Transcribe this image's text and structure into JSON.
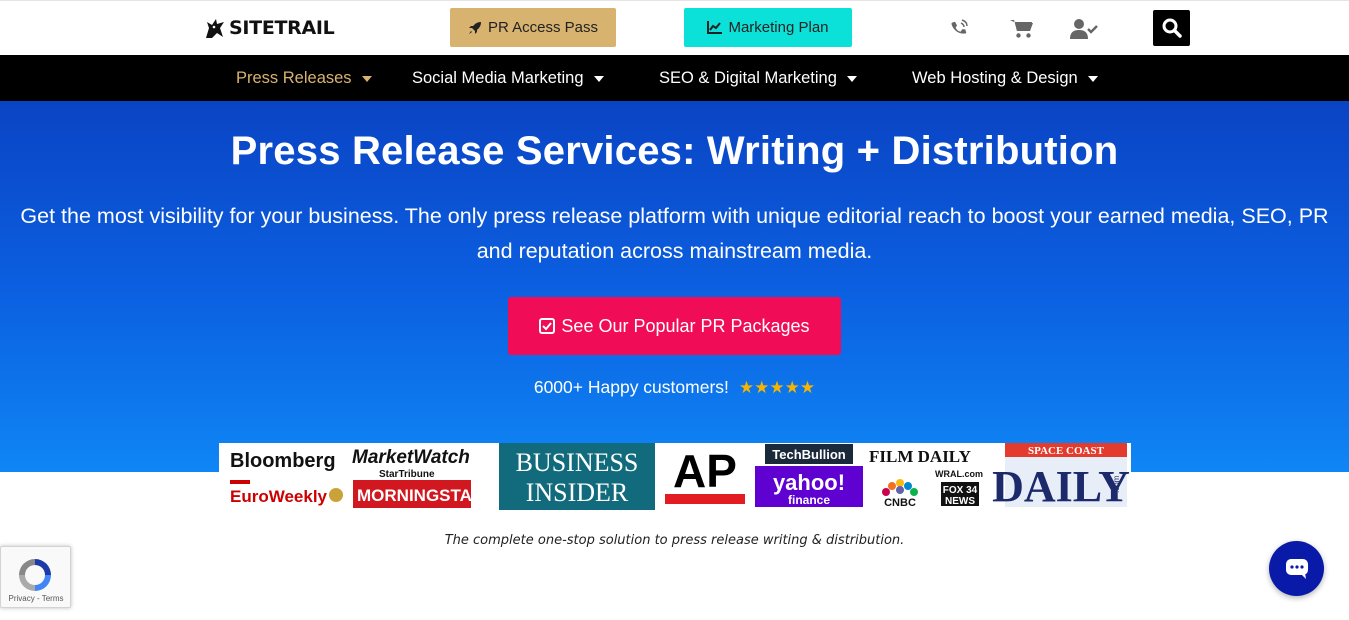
{
  "header": {
    "logo_text": "SITETRAIL",
    "pr_access_label": "PR Access Pass",
    "marketing_plan_label": "Marketing Plan",
    "icons": [
      "phone-icon",
      "cart-icon",
      "user-check-icon",
      "search-icon"
    ]
  },
  "nav": {
    "items": [
      {
        "label": "Press Releases",
        "active": true
      },
      {
        "label": "Social Media Marketing",
        "active": false
      },
      {
        "label": "SEO & Digital Marketing",
        "active": false
      },
      {
        "label": "Web Hosting & Design",
        "active": false
      }
    ]
  },
  "hero": {
    "title": "Press Release Services: Writing + Distribution",
    "subtitle": "Get the most visibility for your business. The only press release platform with unique editorial reach to boost your earned media, SEO, PR and reputation across mainstream media.",
    "cta_label": "See Our Popular PR Packages",
    "happy_customers": "6000+ Happy customers!",
    "rating_stars": 5
  },
  "media_logos": {
    "bloomberg": "Bloomberg",
    "marketwatch": "MarketWatch",
    "startribune": "StarTribune",
    "euroweekly": "EuroWeekly",
    "morningstar": "MORNINGSTAR",
    "business": "BUSINESS",
    "insider": "INSIDER",
    "ap": "AP",
    "techbullion": "TechBullion",
    "yahoo": "yahoo!",
    "finance": "finance",
    "filmdaily": "FILM DAILY",
    "wral": "WRAL.com",
    "cnbc": "CNBC",
    "fox": "FOX 34",
    "news": "NEWS",
    "spacecoast": "SPACE COAST",
    "daily": "DAILY",
    "dotcom": ".com"
  },
  "tagline": "The complete one-stop solution to press release writing & distribution.",
  "recaptcha": {
    "privacy": "Privacy",
    "separator": " - ",
    "terms": "Terms"
  },
  "colors": {
    "accent_gold": "#d8b36f",
    "accent_cyan": "#0ce1d9",
    "cta_pink": "#f00c57",
    "hero_blue_top": "#0a44c4",
    "hero_blue_bottom": "#0f86f5",
    "chat_blue": "#0a1aa8"
  }
}
